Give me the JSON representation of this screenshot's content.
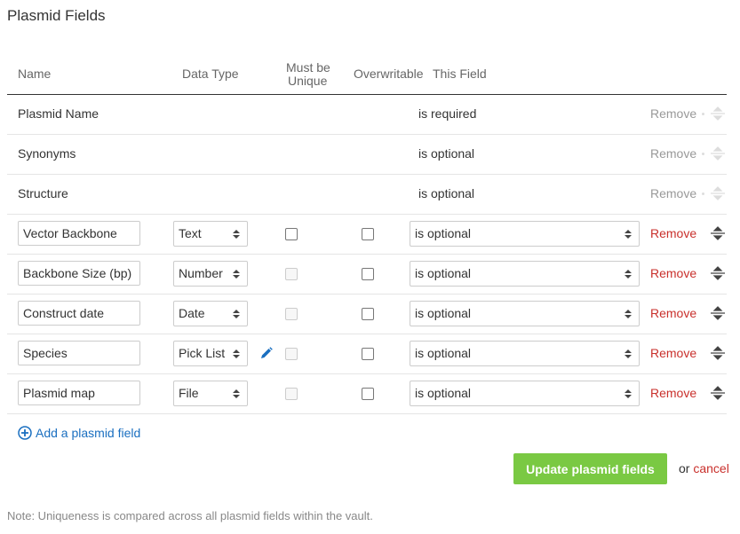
{
  "title": "Plasmid Fields",
  "headers": {
    "name": "Name",
    "data_type": "Data Type",
    "must_be_unique_1": "Must be",
    "must_be_unique_2": "Unique",
    "overwritable": "Overwritable",
    "this_field": "This Field"
  },
  "fixed_rows": [
    {
      "name": "Plasmid Name",
      "status": "is required",
      "remove": "Remove"
    },
    {
      "name": "Synonyms",
      "status": "is optional",
      "remove": "Remove"
    },
    {
      "name": "Structure",
      "status": "is optional",
      "remove": "Remove"
    }
  ],
  "rows": [
    {
      "name": "Vector Backbone",
      "type": "Text",
      "unique": false,
      "unique_enabled": true,
      "overwritable": false,
      "status": "is optional",
      "remove": "Remove"
    },
    {
      "name": "Backbone Size (bp)",
      "type": "Number",
      "unique": false,
      "unique_enabled": false,
      "overwritable": false,
      "status": "is optional",
      "remove": "Remove"
    },
    {
      "name": "Construct date",
      "type": "Date",
      "unique": false,
      "unique_enabled": false,
      "overwritable": false,
      "status": "is optional",
      "remove": "Remove"
    },
    {
      "name": "Species",
      "type": "Pick List",
      "unique": false,
      "unique_enabled": false,
      "overwritable": false,
      "status": "is optional",
      "remove": "Remove",
      "editable_list": true
    },
    {
      "name": "Plasmid map",
      "type": "File",
      "unique": false,
      "unique_enabled": false,
      "overwritable": false,
      "status": "is optional",
      "remove": "Remove"
    }
  ],
  "add_field_label": "Add a plasmid field",
  "update_button": "Update plasmid fields",
  "or_text": "or",
  "cancel_text": "cancel",
  "note": "Note: Uniqueness is compared across all plasmid fields within the vault.",
  "colors": {
    "accent_green": "#7ac943",
    "remove_red": "#c9302c",
    "link_blue": "#1a6fc0"
  }
}
